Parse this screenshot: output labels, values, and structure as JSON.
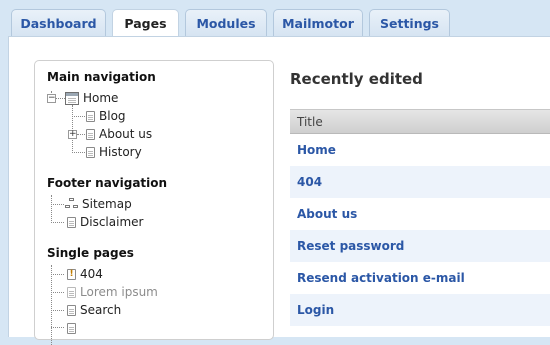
{
  "tabs": [
    {
      "label": "Dashboard",
      "active": false
    },
    {
      "label": "Pages",
      "active": true
    },
    {
      "label": "Modules",
      "active": false
    },
    {
      "label": "Mailmotor",
      "active": false
    },
    {
      "label": "Settings",
      "active": false
    }
  ],
  "tree": {
    "main_navigation": {
      "title": "Main navigation",
      "home": "Home",
      "children": [
        "Blog",
        "About us",
        "History"
      ]
    },
    "footer_navigation": {
      "title": "Footer navigation",
      "items": [
        "Sitemap",
        "Disclaimer"
      ]
    },
    "single_pages": {
      "title": "Single pages",
      "items": [
        "404",
        "Lorem ipsum",
        "Search"
      ]
    }
  },
  "recently_edited": {
    "title": "Recently edited",
    "column_title": "Title",
    "rows": [
      "Home",
      "404",
      "About us",
      "Reset password",
      "Resend activation e-mail",
      "Login"
    ]
  }
}
